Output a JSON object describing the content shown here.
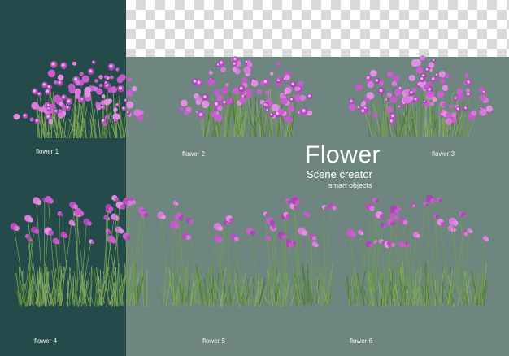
{
  "title": "Flower",
  "subtitle": "Scene creator",
  "subtitle2": "smart objects",
  "labels": [
    "flower 1",
    "flower 2",
    "flower 3",
    "flower 4",
    "flower 5",
    "flower 6"
  ],
  "colors": {
    "left_panel": "#254a4a",
    "background": "#6e8580",
    "flower_pink": "#c45bc8",
    "flower_light": "#e7a6ea",
    "grass": "#5f8a45"
  }
}
